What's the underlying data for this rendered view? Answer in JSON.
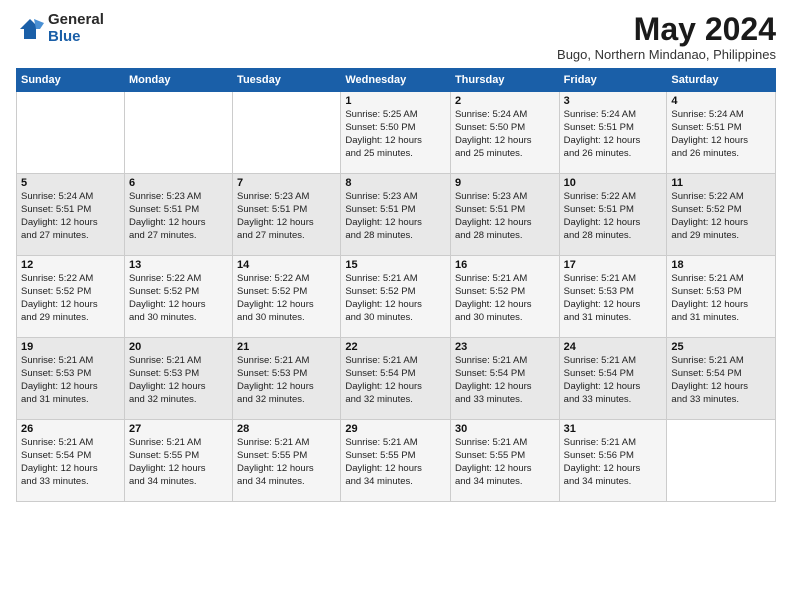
{
  "logo": {
    "general": "General",
    "blue": "Blue"
  },
  "title": "May 2024",
  "location": "Bugo, Northern Mindanao, Philippines",
  "days_of_week": [
    "Sunday",
    "Monday",
    "Tuesday",
    "Wednesday",
    "Thursday",
    "Friday",
    "Saturday"
  ],
  "weeks": [
    [
      {
        "day": "",
        "info": ""
      },
      {
        "day": "",
        "info": ""
      },
      {
        "day": "",
        "info": ""
      },
      {
        "day": "1",
        "info": "Sunrise: 5:25 AM\nSunset: 5:50 PM\nDaylight: 12 hours\nand 25 minutes."
      },
      {
        "day": "2",
        "info": "Sunrise: 5:24 AM\nSunset: 5:50 PM\nDaylight: 12 hours\nand 25 minutes."
      },
      {
        "day": "3",
        "info": "Sunrise: 5:24 AM\nSunset: 5:51 PM\nDaylight: 12 hours\nand 26 minutes."
      },
      {
        "day": "4",
        "info": "Sunrise: 5:24 AM\nSunset: 5:51 PM\nDaylight: 12 hours\nand 26 minutes."
      }
    ],
    [
      {
        "day": "5",
        "info": "Sunrise: 5:24 AM\nSunset: 5:51 PM\nDaylight: 12 hours\nand 27 minutes."
      },
      {
        "day": "6",
        "info": "Sunrise: 5:23 AM\nSunset: 5:51 PM\nDaylight: 12 hours\nand 27 minutes."
      },
      {
        "day": "7",
        "info": "Sunrise: 5:23 AM\nSunset: 5:51 PM\nDaylight: 12 hours\nand 27 minutes."
      },
      {
        "day": "8",
        "info": "Sunrise: 5:23 AM\nSunset: 5:51 PM\nDaylight: 12 hours\nand 28 minutes."
      },
      {
        "day": "9",
        "info": "Sunrise: 5:23 AM\nSunset: 5:51 PM\nDaylight: 12 hours\nand 28 minutes."
      },
      {
        "day": "10",
        "info": "Sunrise: 5:22 AM\nSunset: 5:51 PM\nDaylight: 12 hours\nand 28 minutes."
      },
      {
        "day": "11",
        "info": "Sunrise: 5:22 AM\nSunset: 5:52 PM\nDaylight: 12 hours\nand 29 minutes."
      }
    ],
    [
      {
        "day": "12",
        "info": "Sunrise: 5:22 AM\nSunset: 5:52 PM\nDaylight: 12 hours\nand 29 minutes."
      },
      {
        "day": "13",
        "info": "Sunrise: 5:22 AM\nSunset: 5:52 PM\nDaylight: 12 hours\nand 30 minutes."
      },
      {
        "day": "14",
        "info": "Sunrise: 5:22 AM\nSunset: 5:52 PM\nDaylight: 12 hours\nand 30 minutes."
      },
      {
        "day": "15",
        "info": "Sunrise: 5:21 AM\nSunset: 5:52 PM\nDaylight: 12 hours\nand 30 minutes."
      },
      {
        "day": "16",
        "info": "Sunrise: 5:21 AM\nSunset: 5:52 PM\nDaylight: 12 hours\nand 30 minutes."
      },
      {
        "day": "17",
        "info": "Sunrise: 5:21 AM\nSunset: 5:53 PM\nDaylight: 12 hours\nand 31 minutes."
      },
      {
        "day": "18",
        "info": "Sunrise: 5:21 AM\nSunset: 5:53 PM\nDaylight: 12 hours\nand 31 minutes."
      }
    ],
    [
      {
        "day": "19",
        "info": "Sunrise: 5:21 AM\nSunset: 5:53 PM\nDaylight: 12 hours\nand 31 minutes."
      },
      {
        "day": "20",
        "info": "Sunrise: 5:21 AM\nSunset: 5:53 PM\nDaylight: 12 hours\nand 32 minutes."
      },
      {
        "day": "21",
        "info": "Sunrise: 5:21 AM\nSunset: 5:53 PM\nDaylight: 12 hours\nand 32 minutes."
      },
      {
        "day": "22",
        "info": "Sunrise: 5:21 AM\nSunset: 5:54 PM\nDaylight: 12 hours\nand 32 minutes."
      },
      {
        "day": "23",
        "info": "Sunrise: 5:21 AM\nSunset: 5:54 PM\nDaylight: 12 hours\nand 33 minutes."
      },
      {
        "day": "24",
        "info": "Sunrise: 5:21 AM\nSunset: 5:54 PM\nDaylight: 12 hours\nand 33 minutes."
      },
      {
        "day": "25",
        "info": "Sunrise: 5:21 AM\nSunset: 5:54 PM\nDaylight: 12 hours\nand 33 minutes."
      }
    ],
    [
      {
        "day": "26",
        "info": "Sunrise: 5:21 AM\nSunset: 5:54 PM\nDaylight: 12 hours\nand 33 minutes."
      },
      {
        "day": "27",
        "info": "Sunrise: 5:21 AM\nSunset: 5:55 PM\nDaylight: 12 hours\nand 34 minutes."
      },
      {
        "day": "28",
        "info": "Sunrise: 5:21 AM\nSunset: 5:55 PM\nDaylight: 12 hours\nand 34 minutes."
      },
      {
        "day": "29",
        "info": "Sunrise: 5:21 AM\nSunset: 5:55 PM\nDaylight: 12 hours\nand 34 minutes."
      },
      {
        "day": "30",
        "info": "Sunrise: 5:21 AM\nSunset: 5:55 PM\nDaylight: 12 hours\nand 34 minutes."
      },
      {
        "day": "31",
        "info": "Sunrise: 5:21 AM\nSunset: 5:56 PM\nDaylight: 12 hours\nand 34 minutes."
      },
      {
        "day": "",
        "info": ""
      }
    ]
  ]
}
